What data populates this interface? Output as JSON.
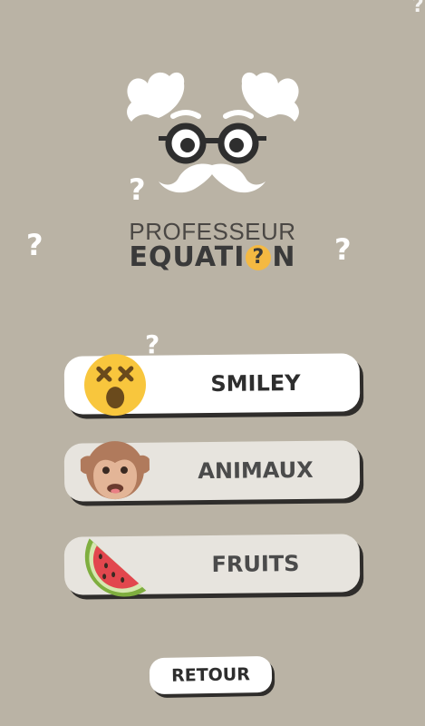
{
  "app": {
    "title_top": "PROFESSEUR",
    "title_bottom_before": "EQUATI",
    "title_bottom_q": "?",
    "title_bottom_after": "N"
  },
  "decor": {
    "question_mark": "?"
  },
  "categories": [
    {
      "label": "SMILEY",
      "icon": "dizzy-face-emoji-icon",
      "state": "selected"
    },
    {
      "label": "ANIMAUX",
      "icon": "monkey-face-emoji-icon",
      "state": "unselected"
    },
    {
      "label": "FRUITS",
      "icon": "watermelon-emoji-icon",
      "state": "unselected"
    }
  ],
  "footer": {
    "back_label": "RETOUR"
  },
  "colors": {
    "background": "#bab3a5",
    "button_active": "#ffffff",
    "button_inactive": "#e7e4de",
    "accent_yellow": "#f4b942",
    "dark_text": "#2e2e2e"
  }
}
